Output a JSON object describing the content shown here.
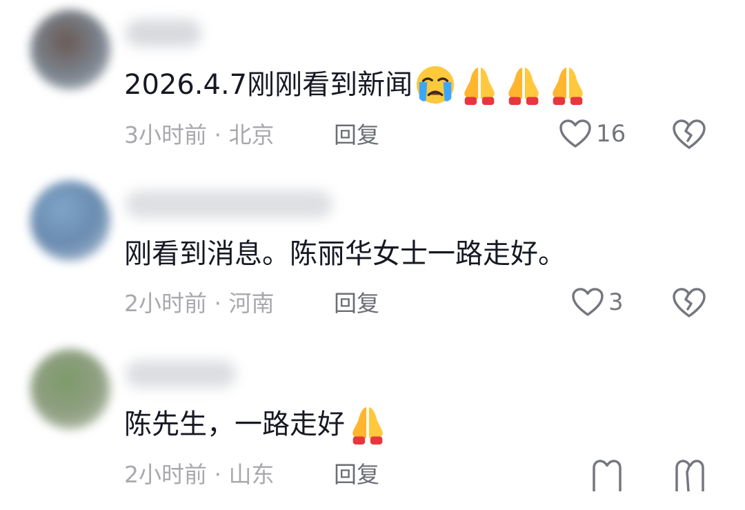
{
  "comments": [
    {
      "text": "2026.4.7刚刚看到新闻",
      "emojis": [
        "crying-face",
        "folded-hands",
        "folded-hands",
        "folded-hands"
      ],
      "time": "3小时前",
      "separator": " · ",
      "location": "北京",
      "reply_label": "回复",
      "likes": "16"
    },
    {
      "text": "刚看到消息。陈丽华女士一路走好。",
      "emojis": [],
      "time": "2小时前",
      "separator": " · ",
      "location": "河南",
      "reply_label": "回复",
      "likes": "3"
    },
    {
      "text": "陈先生，一路走好",
      "emojis": [
        "folded-hands"
      ],
      "time": "2小时前",
      "separator": " · ",
      "location": "山东",
      "reply_label": "回复",
      "likes": ""
    }
  ],
  "colors": {
    "text": "#161823",
    "meta": "#a8a9ad",
    "reply": "#6b6d75",
    "icon": "#75777e"
  }
}
